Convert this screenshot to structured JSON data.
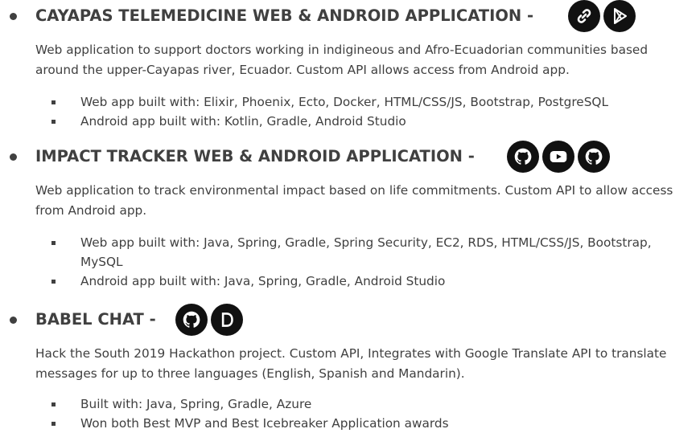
{
  "projects": [
    {
      "title": "CAYAPAS TELEMEDICINE WEB & ANDROID APPLICATION -",
      "icons": [
        "link-icon",
        "google-play-icon"
      ],
      "description": "Web application to support doctors working in indigineous and Afro-Ecuadorian communities based around the upper-Cayapas river, Ecuador. Custom API allows access from Android app.",
      "items": [
        "Web app built with: Elixir, Phoenix, Ecto, Docker, HTML/CSS/JS, Bootstrap, PostgreSQL",
        "Android app built with:  Kotlin, Gradle, Android Studio"
      ]
    },
    {
      "title": "IMPACT TRACKER WEB & ANDROID APPLICATION -",
      "icons": [
        "github-icon",
        "youtube-icon",
        "github-icon"
      ],
      "description": "Web application to track environmental impact based on life commitments. Custom API to allow access from Android app.",
      "items": [
        "Web app built with: Java, Spring, Gradle, Spring Security, EC2, RDS, HTML/CSS/JS, Bootstrap, MySQL",
        "Android app built with:  Java, Spring, Gradle, Android Studio"
      ]
    },
    {
      "title": "BABEL CHAT -",
      "icons": [
        "github-icon",
        "devpost-icon"
      ],
      "description": "Hack the South 2019 Hackathon project. Custom API, Integrates with Google Translate API to translate messages for up to three languages (English, Spanish and Mandarin).",
      "items": [
        "Built with:  Java, Spring, Gradle, Azure",
        "Won both Best MVP and Best Icebreaker Application awards"
      ]
    }
  ],
  "colors": {
    "text": "#404040",
    "icon_bg": "#111111",
    "icon_fg": "#ffffff"
  }
}
